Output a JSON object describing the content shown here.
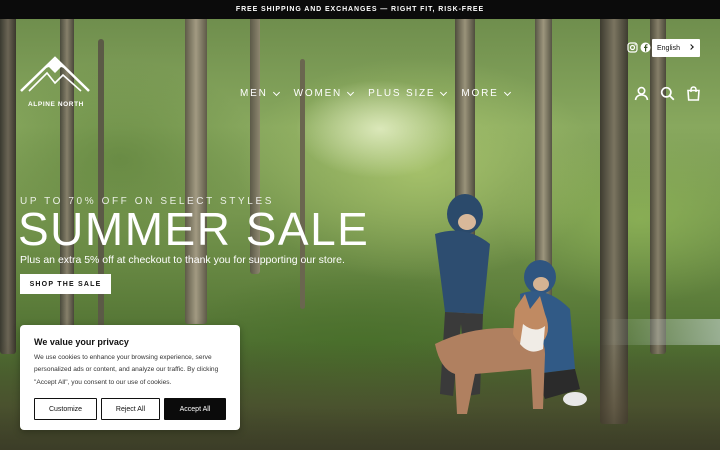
{
  "announcement": {
    "text": "FREE SHIPPING AND EXCHANGES — RIGHT FIT, RISK-FREE"
  },
  "brand": {
    "name": "ALPINE NORTH",
    "logo_icon": "mountain-logo-icon"
  },
  "nav": {
    "items": [
      {
        "label": "MEN"
      },
      {
        "label": "WOMEN"
      },
      {
        "label": "PLUS SIZE"
      },
      {
        "label": "MORE"
      }
    ]
  },
  "header_icons": {
    "social": [
      "instagram-icon",
      "facebook-icon"
    ],
    "utility": [
      "account-icon",
      "search-icon",
      "cart-icon"
    ]
  },
  "language": {
    "selected": "English"
  },
  "hero": {
    "eyebrow": "UP TO 70% OFF ON SELECT STYLES",
    "headline": "SUMMER SALE",
    "subline": "Plus an extra 5% off at checkout to thank you for supporting our store.",
    "cta_label": "SHOP THE SALE"
  },
  "cookie_banner": {
    "title": "We value your privacy",
    "body": "We use cookies to enhance your browsing experience, serve personalized ads or content, and analyze our traffic. By clicking \"Accept All\", you consent to our use of cookies.",
    "buttons": {
      "customize": "Customize",
      "reject": "Reject All",
      "accept": "Accept All"
    }
  },
  "colors": {
    "announcement_bg": "#0b0b0b",
    "button_dark": "#0b0b0b",
    "text_light": "#ffffff"
  }
}
